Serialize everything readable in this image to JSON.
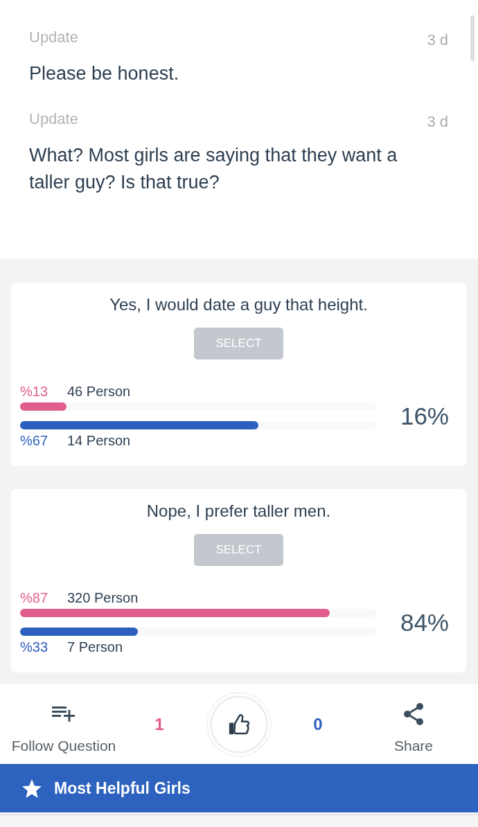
{
  "updates": [
    {
      "label": "Update",
      "age": "3 d",
      "text": "Please be honest."
    },
    {
      "label": "Update",
      "age": "3 d",
      "text": "What? Most girls are saying that they want a taller guy? Is that true?"
    }
  ],
  "poll_options": [
    {
      "text": "Yes, I would date a guy that height.",
      "button": "SELECT",
      "total": "16%",
      "groups": [
        {
          "percent": "%13",
          "count": "46 Person",
          "level": 0.13,
          "color": "#e15d8e"
        },
        {
          "percent": "%67",
          "count": "14 Person",
          "level": 0.67,
          "color": "#2d5fbf"
        }
      ]
    },
    {
      "text": "Nope, I prefer taller men.",
      "button": "SELECT",
      "total": "84%",
      "groups": [
        {
          "percent": "%87",
          "count": "320 Person",
          "level": 0.87,
          "color": "#e15d8e"
        },
        {
          "percent": "%33",
          "count": "7 Person",
          "level": 0.33,
          "color": "#2d5fbf"
        }
      ]
    }
  ],
  "actions": {
    "follow": "Follow Question",
    "tallies": [
      {
        "count": "1",
        "color": "#e15d8e"
      },
      {
        "count": "0",
        "color": "#2d5fbf"
      }
    ],
    "share": "Share"
  },
  "banner": {
    "title": "Most Helpful Girls"
  }
}
